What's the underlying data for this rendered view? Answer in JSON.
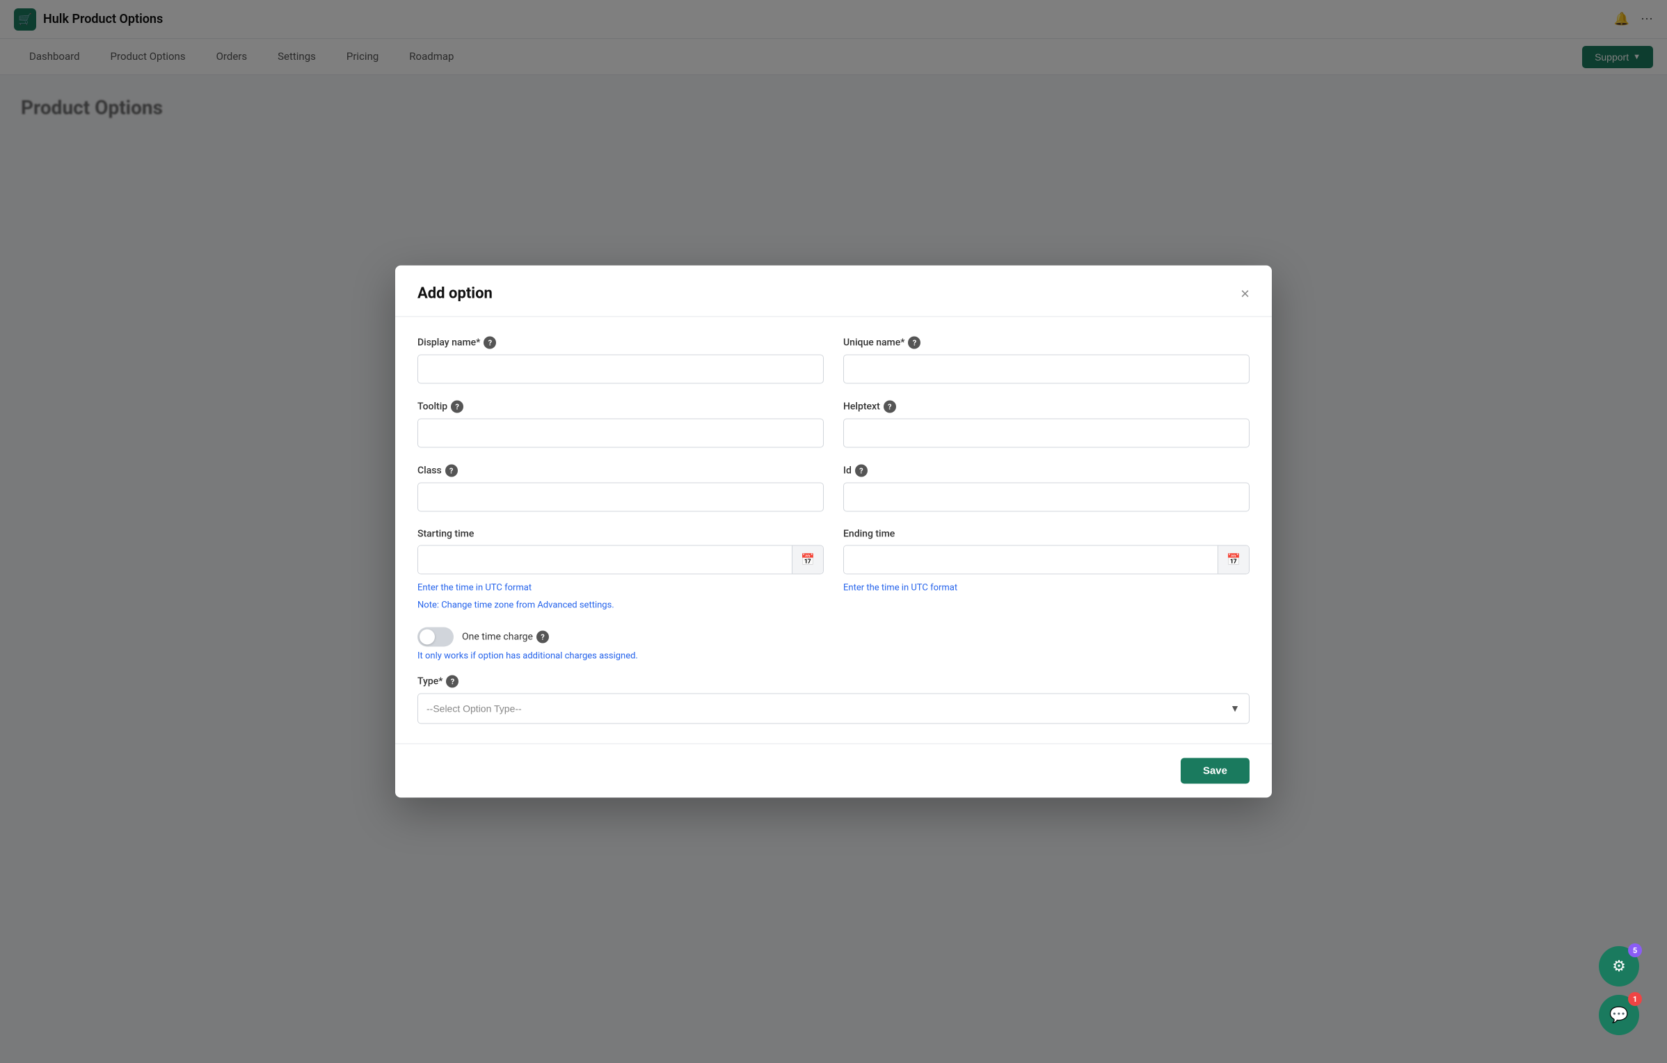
{
  "app": {
    "title": "Hulk Product Options",
    "logo_emoji": "🛒"
  },
  "nav": {
    "items": [
      {
        "label": "Dashboard"
      },
      {
        "label": "Product Options"
      },
      {
        "label": "Orders"
      },
      {
        "label": "Settings"
      },
      {
        "label": "Pricing"
      },
      {
        "label": "Roadmap"
      }
    ],
    "support_label": "Support"
  },
  "background": {
    "page_title": "Product Options"
  },
  "modal": {
    "title": "Add option",
    "close_label": "×",
    "fields": {
      "display_name_label": "Display name*",
      "unique_name_label": "Unique name*",
      "tooltip_label": "Tooltip",
      "helptext_label": "Helptext",
      "class_label": "Class",
      "id_label": "Id",
      "starting_time_label": "Starting time",
      "ending_time_label": "Ending time",
      "starting_time_hint": "Enter the time in UTC format",
      "ending_time_hint": "Enter the time in UTC format",
      "timezone_note": "Note: Change time zone from Advanced settings.",
      "one_time_charge_label": "One time charge",
      "one_time_charge_note": "It only works if option has additional charges assigned.",
      "type_label": "Type*",
      "type_placeholder": "--Select Option Type--"
    },
    "save_label": "Save"
  },
  "chat": {
    "badge1_count": "5",
    "badge2_count": "1"
  },
  "icons": {
    "bell": "🔔",
    "more": "⋯",
    "calendar": "📅",
    "chevron_down": "▼",
    "chat_icon": "💬",
    "settings_icon": "⚙"
  }
}
